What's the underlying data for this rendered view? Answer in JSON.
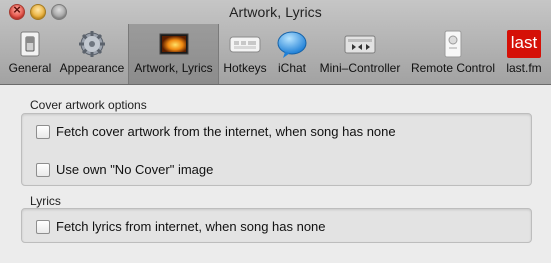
{
  "window": {
    "title": "Artwork, Lyrics"
  },
  "toolbar": {
    "items": [
      {
        "label": "General",
        "icon": "switch-icon"
      },
      {
        "label": "Appearance",
        "icon": "gear-icon"
      },
      {
        "label": "Artwork, Lyrics",
        "icon": "artwork-icon",
        "selected": true
      },
      {
        "label": "Hotkeys",
        "icon": "keyboard-icon"
      },
      {
        "label": "iChat",
        "icon": "ichat-bubble-icon"
      },
      {
        "label": "Mini–Controller",
        "icon": "mini-controller-icon"
      },
      {
        "label": "Remote Control",
        "icon": "remote-icon"
      },
      {
        "label": "last.fm",
        "icon": "lastfm-icon"
      }
    ],
    "lastfm_logo_text": "last"
  },
  "cover_section": {
    "label": "Cover artwork options",
    "options": [
      {
        "label": "Fetch cover artwork from the internet, when song has none",
        "checked": false
      },
      {
        "label": "Use own \"No Cover\" image",
        "checked": false
      }
    ]
  },
  "lyrics_section": {
    "label": "Lyrics",
    "options": [
      {
        "label": "Fetch lyrics from internet, when song has none",
        "checked": false
      }
    ]
  }
}
